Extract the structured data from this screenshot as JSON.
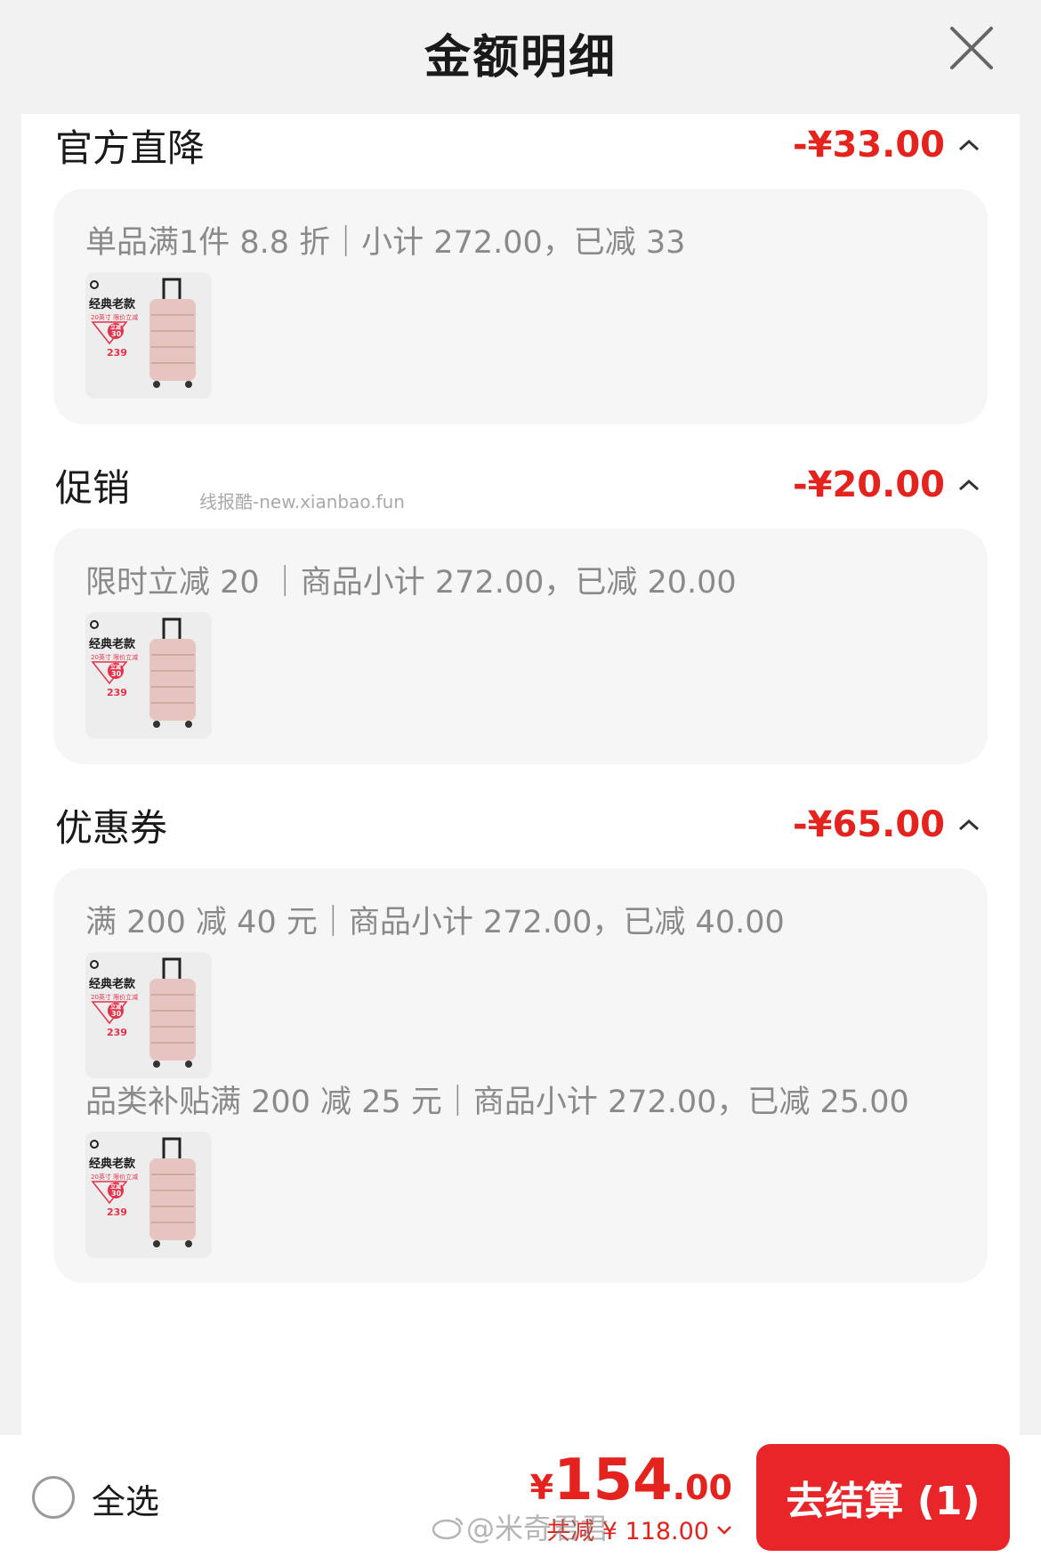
{
  "header": {
    "title": "金额明细"
  },
  "sections": [
    {
      "title": "官方直降",
      "amount": "-¥33.00",
      "rules": [
        {
          "text": "单品满1件 8.8 折｜小计 272.00，已减 33"
        }
      ]
    },
    {
      "title": "促销",
      "amount": "-¥20.00",
      "rules": [
        {
          "text": "限时立减 20 ｜商品小计 272.00，已减 20.00"
        }
      ]
    },
    {
      "title": "优惠券",
      "amount": "-¥65.00",
      "rules": [
        {
          "text": "满 200 减 40 元｜商品小计 272.00，已减 40.00"
        },
        {
          "text": "品类补贴满 200 减 25 元｜商品小计 272.00，已减 25.00"
        }
      ]
    }
  ],
  "product_thumb": {
    "tag": "经典老款",
    "sub": "20英寸 限价立减",
    "badge_line1": "立减",
    "badge_line2": "30",
    "price": "239"
  },
  "watermark": "线报酷-new.xianbao.fun",
  "footer": {
    "select_all": "全选",
    "total_currency": "¥",
    "total_int": "154",
    "total_dec": ".00",
    "saved": "共减 ¥ 118.00",
    "checkout": "去结算 (1)",
    "weibo_watermark": "@米奇君君"
  },
  "colors": {
    "accent": "#e4231e",
    "button": "#e8262a",
    "card_bg": "#f6f6f6",
    "page_bg": "#f2f2f2"
  },
  "icons": {
    "close": "close-icon",
    "collapse": "chevron-up-icon",
    "expand": "chevron-down-icon",
    "radio": "radio-unchecked-icon"
  }
}
